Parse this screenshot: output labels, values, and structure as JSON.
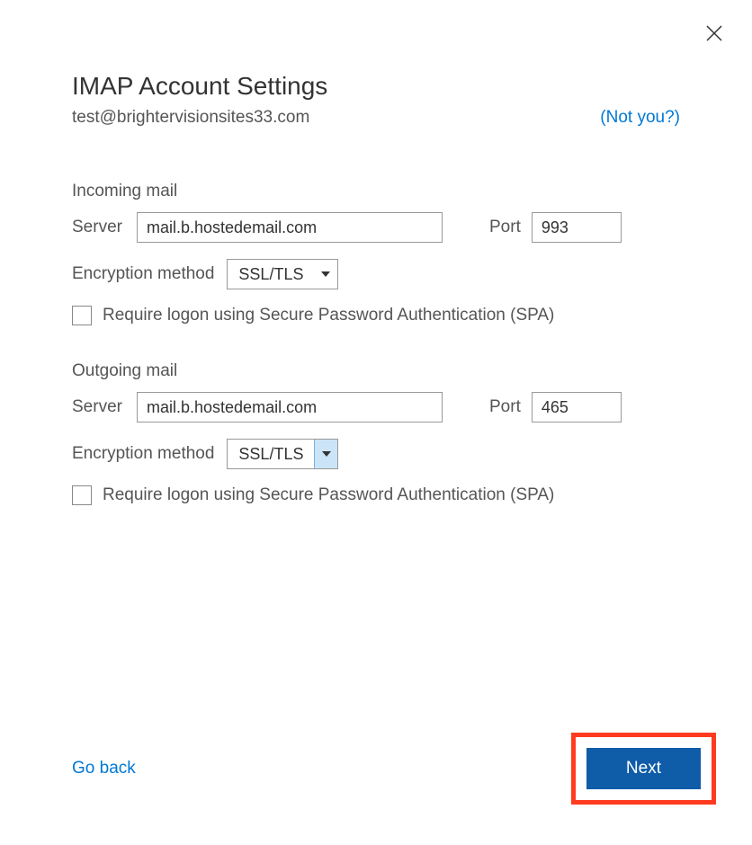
{
  "dialog": {
    "title": "IMAP Account Settings",
    "email": "test@brightervisionsites33.com",
    "not_you": "(Not you?)"
  },
  "incoming": {
    "heading": "Incoming mail",
    "server_label": "Server",
    "server_value": "mail.b.hostedemail.com",
    "port_label": "Port",
    "port_value": "993",
    "encryption_label": "Encryption method",
    "encryption_value": "SSL/TLS",
    "spa_label": "Require logon using Secure Password Authentication (SPA)"
  },
  "outgoing": {
    "heading": "Outgoing mail",
    "server_label": "Server",
    "server_value": "mail.b.hostedemail.com",
    "port_label": "Port",
    "port_value": "465",
    "encryption_label": "Encryption method",
    "encryption_value": "SSL/TLS",
    "spa_label": "Require logon using Secure Password Authentication (SPA)"
  },
  "footer": {
    "go_back": "Go back",
    "next": "Next"
  }
}
